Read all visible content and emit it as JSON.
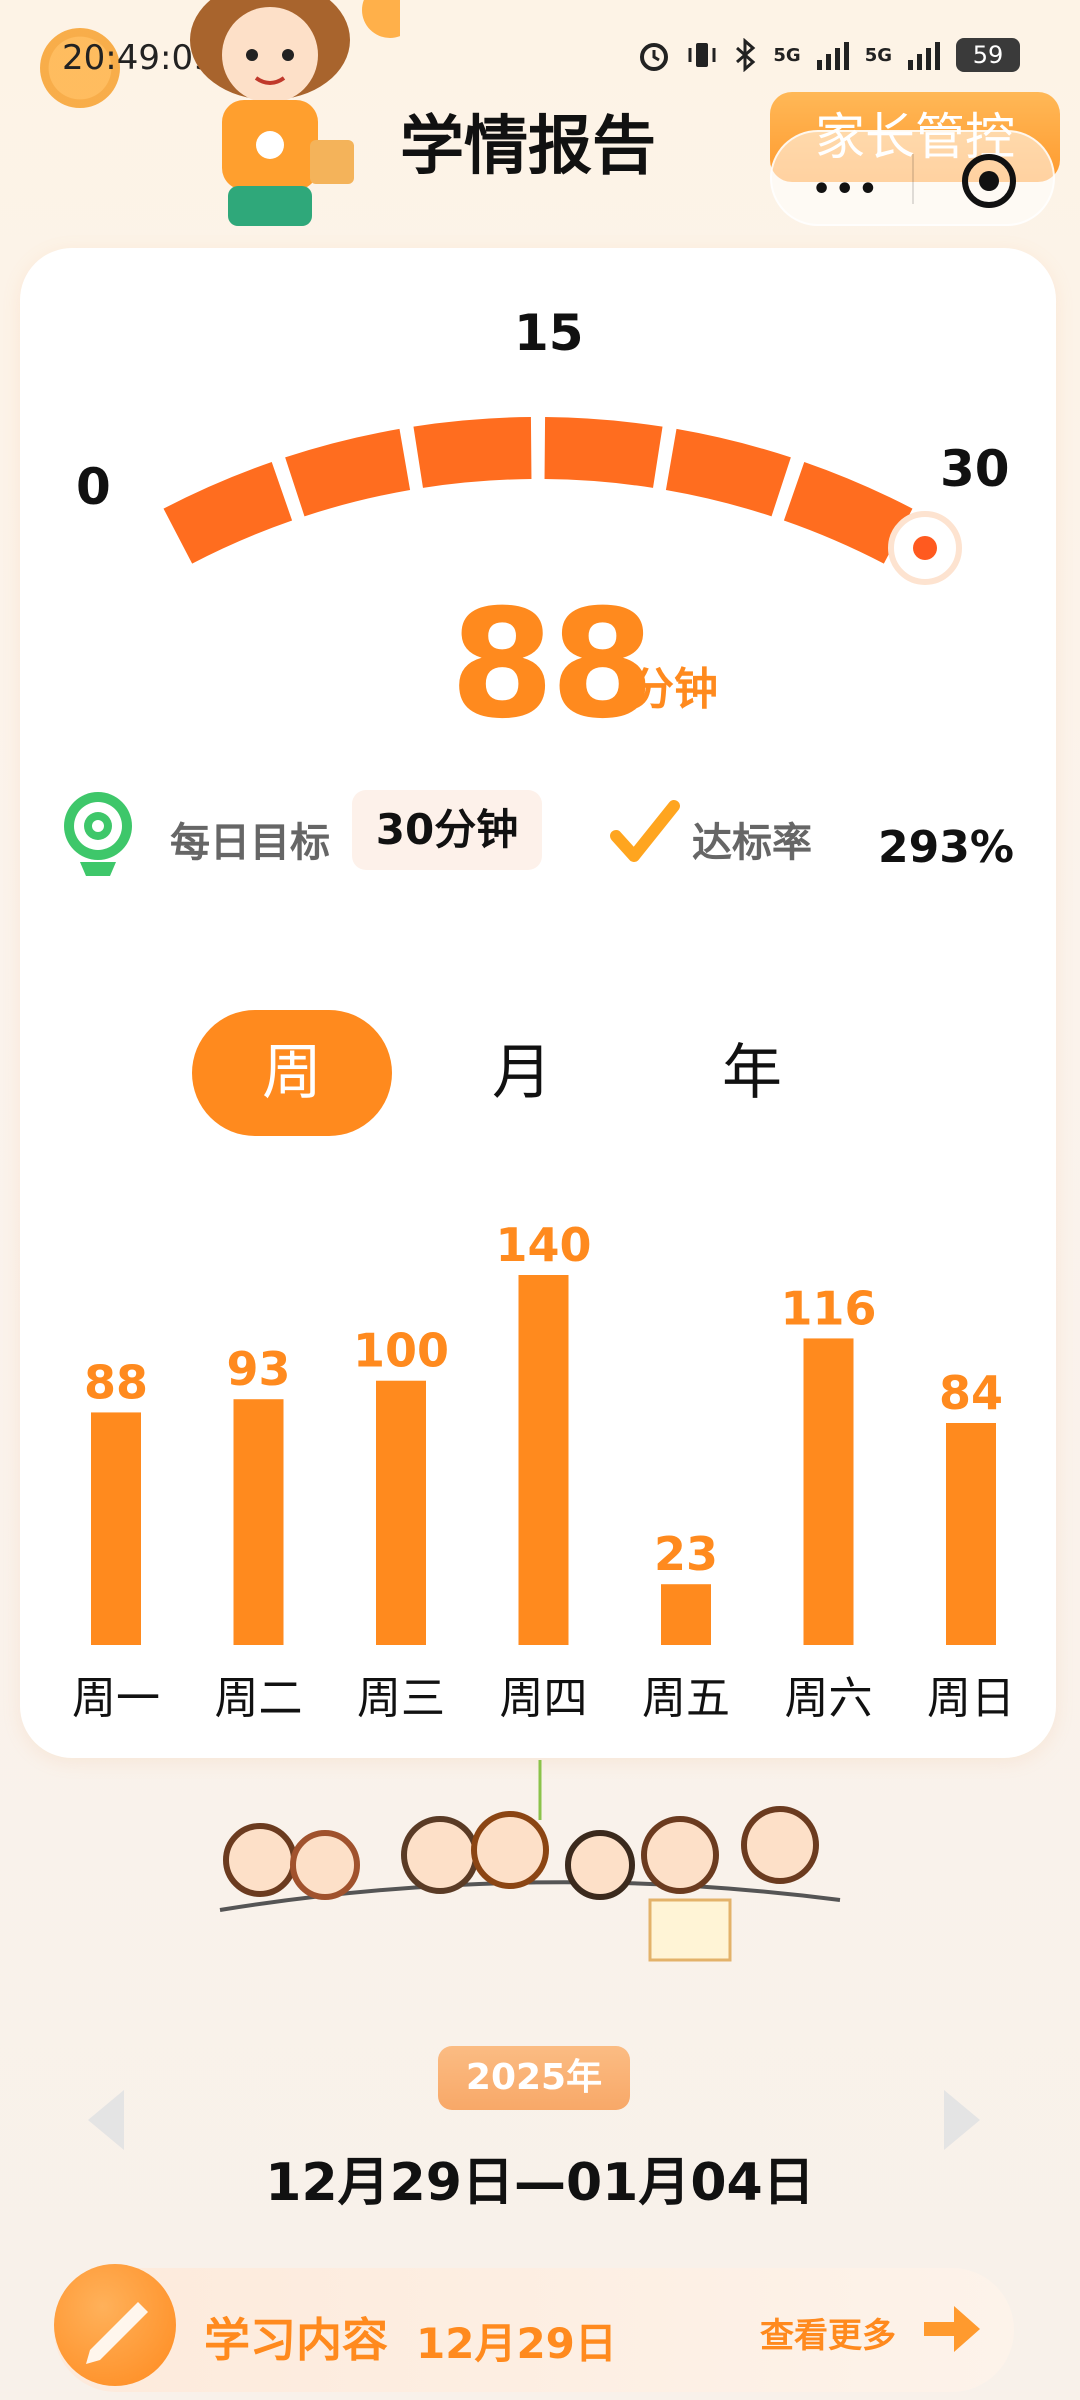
{
  "status_bar": {
    "time": "20:49:09",
    "signal_1": "5G",
    "signal_2": "5G",
    "battery": "59"
  },
  "header": {
    "title": "学情报告",
    "parent_control_label": "家长管控",
    "capsule_more": "•••"
  },
  "gauge": {
    "min_label": "0",
    "mid_label": "15",
    "max_label": "30",
    "goal": 30,
    "total_minutes": "88",
    "unit": "分钟",
    "accent": "#ff6d1f"
  },
  "goal": {
    "label": "每日目标",
    "value": "30分钟",
    "rate_label": "达标率",
    "rate_value": "293%"
  },
  "tabs": [
    {
      "label": "周",
      "active": true
    },
    {
      "label": "月",
      "active": false
    },
    {
      "label": "年",
      "active": false
    }
  ],
  "chart_data": {
    "type": "bar",
    "categories": [
      "周一",
      "周二",
      "周三",
      "周四",
      "周五",
      "周六",
      "周日"
    ],
    "values": [
      88,
      93,
      100,
      140,
      23,
      116,
      84
    ],
    "color": "#ff8a1e"
  },
  "date": {
    "year": "2025年",
    "range": "12月29日—01月04日"
  },
  "content": {
    "title": "学习内容",
    "date": "12月29日",
    "see_more": "查看更多"
  },
  "icons": {
    "target": "target-icon",
    "check": "check-icon",
    "pencil": "pencil-icon",
    "arrow": "arrow-right-icon",
    "prev": "chevron-left-icon",
    "next": "chevron-right-icon"
  }
}
